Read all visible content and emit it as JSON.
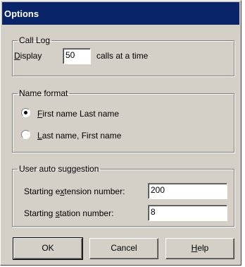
{
  "window": {
    "title": "Options"
  },
  "call_log": {
    "legend": "Call Log",
    "display_mnemonic": "D",
    "display_rest": "isplay",
    "value": "50",
    "suffix": "calls at a time"
  },
  "name_format": {
    "legend": "Name format",
    "options": [
      {
        "mnemonic": "F",
        "rest": "irst name Last name",
        "selected": true
      },
      {
        "mnemonic": "L",
        "rest": "ast name, First name",
        "selected": false
      }
    ]
  },
  "auto_suggestion": {
    "legend": "User auto suggestion",
    "ext_pre": "Starting e",
    "ext_mnemonic": "x",
    "ext_post": "tension number:",
    "ext_value": "200",
    "station_pre": "Starting ",
    "station_mnemonic": "s",
    "station_post": "tation number:",
    "station_value": "8"
  },
  "buttons": {
    "ok": "OK",
    "cancel": "Cancel",
    "help_mnemonic": "H",
    "help_rest": "elp"
  }
}
